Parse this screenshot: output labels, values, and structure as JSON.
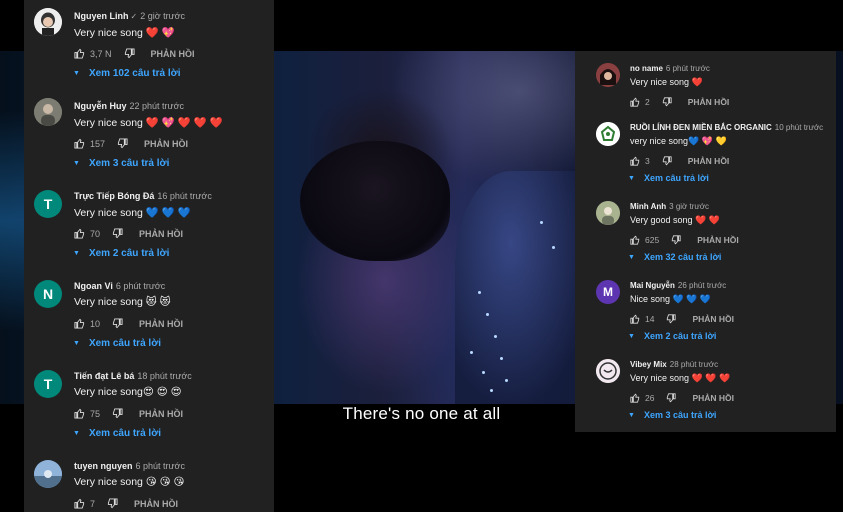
{
  "video": {
    "subtitle": "There's no one at all"
  },
  "left_comments": [
    {
      "author": "Nguyen Linh",
      "verified": true,
      "time": "2 giờ trước",
      "text": "Very nice song ❤️ 💖",
      "likes": "3,7 N",
      "reply": "PHẢN HỒI",
      "replies": "Xem 102 câu trả lời",
      "avatar_letter": "",
      "avatar_color": "#eeeeee"
    },
    {
      "author": "Nguyễn Huy",
      "verified": false,
      "time": "22 phút trước",
      "text": "Very nice song ❤️ 💖 ❤️ ❤️ ❤️",
      "likes": "157",
      "reply": "PHẢN HỒI",
      "replies": "Xem 3 câu trả lời",
      "avatar_letter": "",
      "avatar_color": "#8a8a80"
    },
    {
      "author": "Trực Tiếp Bóng Đá",
      "verified": false,
      "time": "16 phút trước",
      "text": "Very nice song 💙 💙 💙",
      "likes": "70",
      "reply": "PHẢN HỒI",
      "replies": "Xem 2 câu trả lời",
      "avatar_letter": "T",
      "avatar_color": "#00897b"
    },
    {
      "author": "Ngoan Vi",
      "verified": false,
      "time": "6 phút trước",
      "text": "Very nice song 😻 😻",
      "likes": "10",
      "reply": "PHẢN HỒI",
      "replies": "Xem câu trả lời",
      "avatar_letter": "N",
      "avatar_color": "#00897b"
    },
    {
      "author": "Tiến đạt Lê bá",
      "verified": false,
      "time": "18 phút trước",
      "text": "Very nice song😍 😍 😍",
      "likes": "75",
      "reply": "PHẢN HỒI",
      "replies": "Xem câu trả lời",
      "avatar_letter": "T",
      "avatar_color": "#00897b"
    },
    {
      "author": "tuyen nguyen",
      "verified": false,
      "time": "6 phút trước",
      "text": "Very nice song 😘 😘 😘",
      "likes": "7",
      "reply": "PHẢN HỒI",
      "replies": "",
      "avatar_letter": "",
      "avatar_color": "#6a8fb0"
    }
  ],
  "right_comments": [
    {
      "author": "no name",
      "time": "6 phút trước",
      "text": "Very nice song ❤️",
      "likes": "2",
      "reply": "PHẢN HỒI",
      "replies": "",
      "avatar_letter": "",
      "avatar_color": "#7a3a3a"
    },
    {
      "author": "RUỒI LÍNH ĐEN MIỀN BẮC ORGANIC",
      "time": "10 phút trước",
      "text": "very nice song💙 💖 💛",
      "likes": "3",
      "reply": "PHẢN HỒI",
      "replies": "Xem câu trả lời",
      "avatar_letter": "",
      "avatar_color": "#ffffff"
    },
    {
      "author": "Minh Anh",
      "time": "3 giờ trước",
      "text": "Very good song ❤️ ❤️",
      "likes": "625",
      "reply": "PHẢN HỒI",
      "replies": "Xem 32 câu trả lời",
      "avatar_letter": "",
      "avatar_color": "#9aa58a"
    },
    {
      "author": "Mai Nguyễn",
      "time": "26 phút trước",
      "text": "Nice song 💙 💙 💙",
      "likes": "14",
      "reply": "PHẢN HỒI",
      "replies": "Xem 2 câu trả lời",
      "avatar_letter": "M",
      "avatar_color": "#5e35b1"
    },
    {
      "author": "Vibey Mix",
      "time": "28 phút trước",
      "text": "Very nice song ❤️ ❤️ ❤️",
      "likes": "26",
      "reply": "PHẢN HỒI",
      "replies": "Xem 3 câu trả lời",
      "avatar_letter": "",
      "avatar_color": "#e8dfe6"
    }
  ],
  "icons": {
    "like": "thumbs-up-icon",
    "dislike": "thumbs-down-icon",
    "expand": "caret-down-icon",
    "verified": "check-icon"
  },
  "colors": {
    "panel": "#212121",
    "link": "#3ea6ff",
    "secondary_text": "#aaaaaa"
  }
}
